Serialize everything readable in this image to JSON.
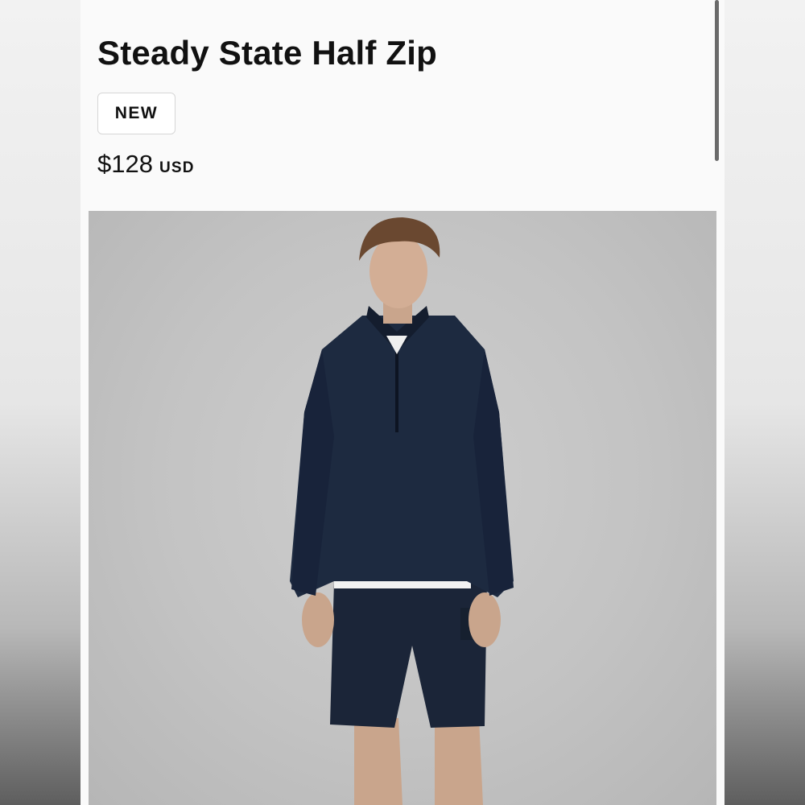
{
  "product": {
    "title": "Steady State Half Zip",
    "badge": "NEW",
    "price": "$128",
    "currency": "USD"
  },
  "image": {
    "description_icon": "product-photo"
  },
  "colors": {
    "garment": "#1d2a40",
    "background": "#c4c4c4",
    "text": "#111111"
  }
}
